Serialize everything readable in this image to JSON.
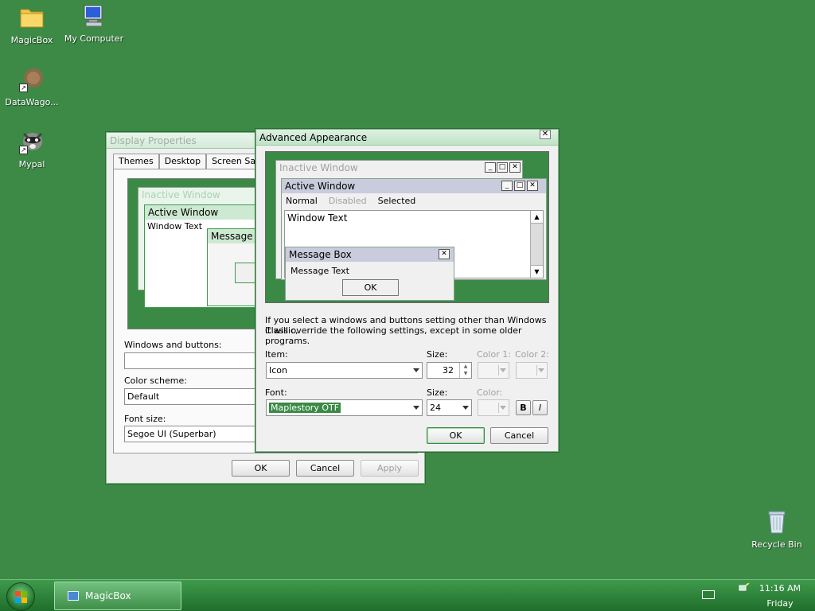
{
  "desktop": {
    "icons": [
      {
        "label": "MagicBox",
        "icon": "folder-icon"
      },
      {
        "label": "My Computer",
        "icon": "computer-icon"
      },
      {
        "label": "DataWago...",
        "icon": "datawagon-icon"
      },
      {
        "label": "Mypal",
        "icon": "raccoon-icon"
      },
      {
        "label": "Recycle Bin",
        "icon": "recycle-bin-icon"
      }
    ]
  },
  "display_properties": {
    "title": "Display Properties",
    "tabs": [
      "Themes",
      "Desktop",
      "Screen Saver"
    ],
    "preview": {
      "inactive_title": "Inactive Window",
      "active_title": "Active Window",
      "window_text": "Window Text",
      "message_title": "Message"
    },
    "windows_buttons_label": "Windows and buttons:",
    "windows_buttons_value": "",
    "color_scheme_label": "Color scheme:",
    "color_scheme_value": "Default",
    "font_size_label": "Font size:",
    "font_size_value": "Segoe UI (Superbar)",
    "buttons": {
      "ok": "OK",
      "cancel": "Cancel",
      "apply": "Apply"
    }
  },
  "advanced_appearance": {
    "title": "Advanced Appearance",
    "preview": {
      "inactive_title": "Inactive Window",
      "active_title": "Active Window",
      "menu": {
        "normal": "Normal",
        "disabled": "Disabled",
        "selected": "Selected"
      },
      "window_text": "Window Text",
      "message_box_title": "Message Box",
      "message_text": "Message Text",
      "message_ok": "OK"
    },
    "info_line1": "If you select a windows and buttons setting other than Windows Classic,",
    "info_line2": "it will override the following settings, except in some older programs.",
    "item_label": "Item:",
    "item_value": "Icon",
    "size_label": "Size:",
    "item_size_value": "32",
    "color1_label": "Color 1:",
    "color2_label": "Color 2:",
    "font_label": "Font:",
    "font_value": "Maplestory OTF",
    "font_size_label": "Size:",
    "font_size_value": "24",
    "font_color_label": "Color:",
    "bold_label": "B",
    "italic_label": "I",
    "buttons": {
      "ok": "OK",
      "cancel": "Cancel"
    }
  },
  "taskbar": {
    "task_label": "MagicBox",
    "time": "11:16 AM",
    "day": "Friday"
  }
}
